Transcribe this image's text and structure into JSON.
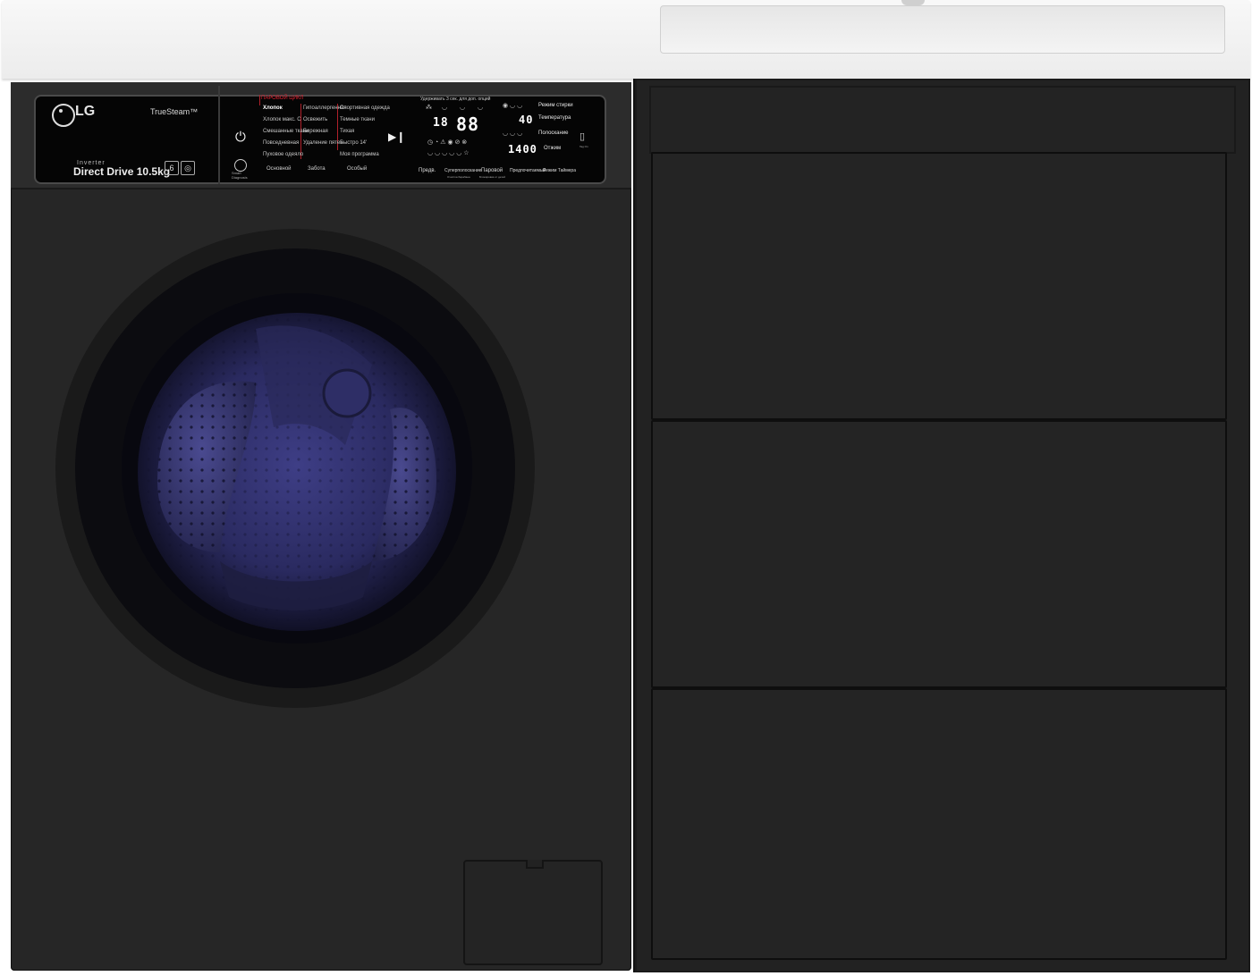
{
  "brand": {
    "logo": "LG",
    "truesteam": "TrueSteam™",
    "inverter": "Inverter",
    "drive": "Direct Drive",
    "capacity": "10.5kg"
  },
  "programs": {
    "steam_header": "ПАРОВОЙ ЦИКЛ",
    "col1": [
      "Хлопок",
      "Хлопок макс. С",
      "Смешанные ткани",
      "Повседневная",
      "Пуховое одеяло"
    ],
    "col2": [
      "Гипоаллергенная",
      "Освежить",
      "Бережная",
      "Удаление пятен"
    ],
    "col3": [
      "Спортивная одежда",
      "Темные ткани",
      "Тихая",
      "Быстро 14'",
      "Моя программа"
    ],
    "groups": [
      "Основной",
      "Забота",
      "Особый"
    ]
  },
  "display": {
    "hint": "Удерживать 3 сек. для доп. опций",
    "time_main": "88",
    "time_small": "18",
    "temp": "40",
    "spin": "1400"
  },
  "options": [
    "Режим стирки",
    "Температура",
    "Полоскание",
    "Отжим"
  ],
  "bottom_buttons": [
    {
      "label": "Предв.",
      "sub": ""
    },
    {
      "label": "Суперполоскание",
      "sub": "Очистка барабана"
    },
    {
      "label": "Паровой",
      "sub": "Блокировка от детей"
    },
    {
      "label": "Предпочитаемый",
      "sub": ""
    },
    {
      "label": "Режим Таймера",
      "sub": ""
    }
  ],
  "tag_on": "Tag On",
  "smart_diagnosis": "Smart Diagnosis",
  "icons": [
    "lg-logo-icon",
    "power-icon",
    "play-pause-icon",
    "smart-diagnosis-icon",
    "tag-on-icon"
  ],
  "colors": {
    "body": "#262626",
    "panel": "#050505",
    "door_rim": "#a6a6a6",
    "drum_glow": "#3a3a8a",
    "countertop": "#f2f2f2",
    "accent_red": "#e02030"
  }
}
